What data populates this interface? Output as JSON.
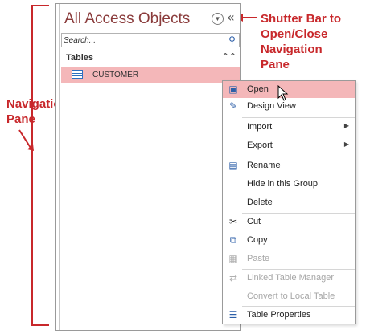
{
  "annotations": {
    "navigation_pane": [
      "Navigation",
      "Pane"
    ],
    "shutter_bar": [
      "Shutter Bar to",
      "Open/Close",
      "Navigation",
      "Pane"
    ],
    "color": "#c8282b"
  },
  "nav_pane": {
    "title": "All Access Objects",
    "menu_icon": "circle-dropdown-icon",
    "shutter_glyph": "«",
    "search_placeholder": "Search...",
    "group": {
      "label": "Tables",
      "collapse_glyph": "⌃"
    },
    "items": [
      {
        "label": "CUSTOMER",
        "icon": "table-icon"
      }
    ]
  },
  "context_menu": {
    "items": [
      {
        "label": "Open",
        "icon": "open-icon",
        "glyph": "▣",
        "highlighted": true
      },
      {
        "label": "Design View",
        "icon": "design-view-icon",
        "glyph": "✎"
      },
      {
        "label": "Import",
        "submenu": true,
        "arrow": "▶"
      },
      {
        "label": "Export",
        "submenu": true,
        "arrow": "▶"
      },
      {
        "label": "Rename",
        "icon": "rename-icon",
        "glyph": "▤"
      },
      {
        "label": "Hide in this Group"
      },
      {
        "label": "Delete"
      },
      {
        "label": "Cut",
        "icon": "scissors-icon",
        "glyph": "✂"
      },
      {
        "label": "Copy",
        "icon": "copy-icon",
        "glyph": "⧉"
      },
      {
        "label": "Paste",
        "icon": "paste-icon",
        "glyph": "📋",
        "disabled": true
      },
      {
        "label": "Linked Table Manager",
        "icon": "linked-table-icon",
        "glyph": "⇄",
        "disabled": true
      },
      {
        "label": "Convert to Local Table",
        "disabled": true
      },
      {
        "label": "Table Properties",
        "icon": "properties-icon",
        "glyph": "☰"
      }
    ]
  },
  "colors": {
    "highlight": "#f4b7b9",
    "title": "#8a3b3b",
    "accent": "#2d5fa8"
  }
}
